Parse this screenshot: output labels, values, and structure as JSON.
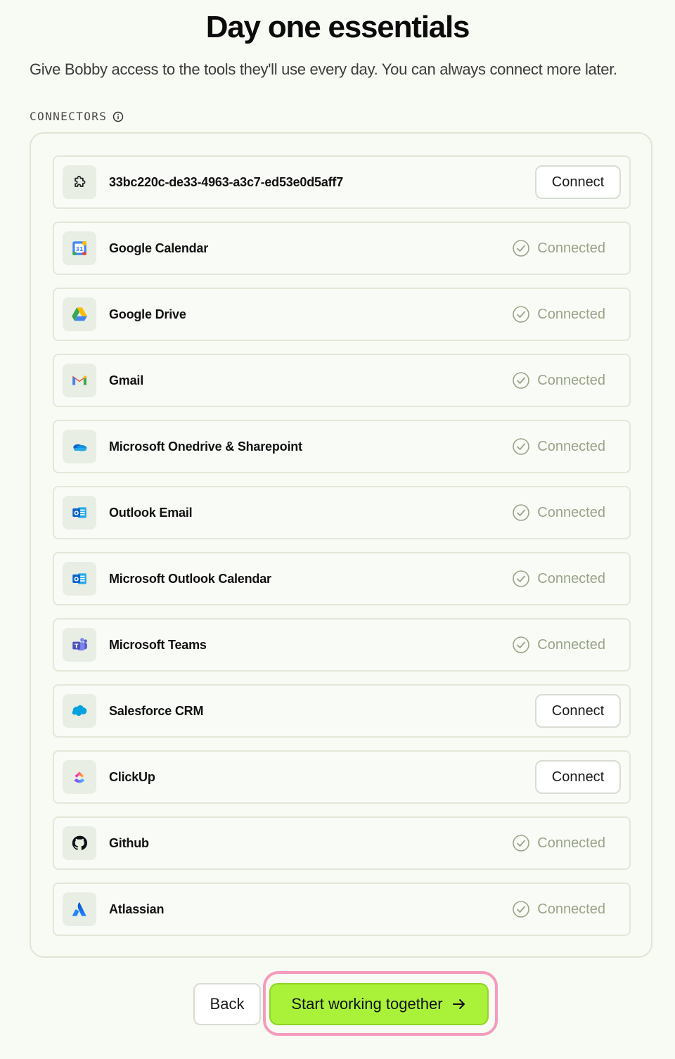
{
  "header": {
    "title": "Day one essentials",
    "subtitle": "Give Bobby access to the tools they'll use every day. You can always connect more later."
  },
  "section": {
    "label": "CONNECTORS",
    "info_icon": "info-icon"
  },
  "connectors": [
    {
      "name": "33bc220c-de33-4963-a3c7-ed53e0d5aff7",
      "status": "Connect",
      "icon": "puzzle-icon"
    },
    {
      "name": "Google Calendar",
      "status": "Connected",
      "icon": "google-calendar-icon"
    },
    {
      "name": "Google Drive",
      "status": "Connected",
      "icon": "google-drive-icon"
    },
    {
      "name": "Gmail",
      "status": "Connected",
      "icon": "gmail-icon"
    },
    {
      "name": "Microsoft Onedrive & Sharepoint",
      "status": "Connected",
      "icon": "onedrive-icon"
    },
    {
      "name": "Outlook Email",
      "status": "Connected",
      "icon": "outlook-icon"
    },
    {
      "name": "Microsoft Outlook Calendar",
      "status": "Connected",
      "icon": "outlook-icon"
    },
    {
      "name": "Microsoft Teams",
      "status": "Connected",
      "icon": "teams-icon"
    },
    {
      "name": "Salesforce CRM",
      "status": "Connect",
      "icon": "salesforce-icon"
    },
    {
      "name": "ClickUp",
      "status": "Connect",
      "icon": "clickup-icon"
    },
    {
      "name": "Github",
      "status": "Connected",
      "icon": "github-icon"
    },
    {
      "name": "Atlassian",
      "status": "Connected",
      "icon": "atlassian-icon"
    }
  ],
  "footer": {
    "back_label": "Back",
    "start_label": "Start working together",
    "start_icon": "arrow-right-icon"
  },
  "colors": {
    "background": "#f8faf4",
    "accent": "#aaf23a",
    "focus_ring": "#f59bbd",
    "connected_text": "#9aa489"
  }
}
